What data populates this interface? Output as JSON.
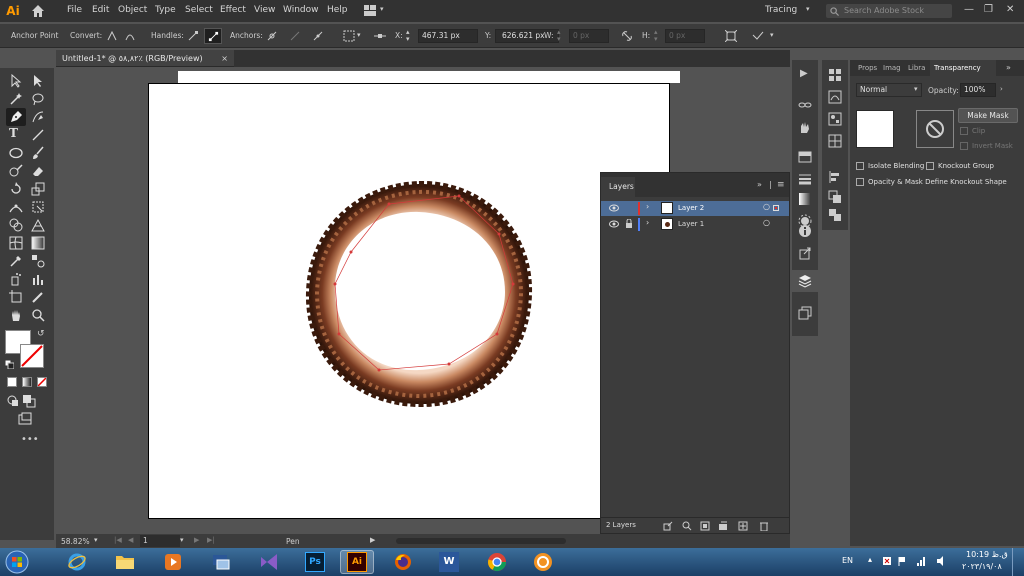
{
  "menubar": {
    "logo": "Ai",
    "menus": [
      "File",
      "Edit",
      "Object",
      "Type",
      "Select",
      "Effect",
      "View",
      "Window",
      "Help"
    ],
    "workspace": "Tracing",
    "search_placeholder": "Search Adobe Stock"
  },
  "control": {
    "tool_label": "Anchor Point",
    "convert_label": "Convert:",
    "handles_label": "Handles:",
    "anchors_label": "Anchors:",
    "x_label": "X:",
    "x_value": "467.31 px",
    "y_label": "Y:",
    "y_value": "626.621 px",
    "w_label": "W:",
    "w_value": "0 px",
    "h_label": "H:",
    "h_value": "0 px"
  },
  "document": {
    "tab_title": "Untitled-1* @ ٥٨,٨٢٪ (RGB/Preview)",
    "close": "×"
  },
  "status": {
    "zoom": "58.82%",
    "page": "1",
    "tool": "Pen"
  },
  "transparency": {
    "tabs": [
      "Props",
      "Imag",
      "Libra",
      "Transparency"
    ],
    "blend_mode": "Normal",
    "opacity_label": "Opacity:",
    "opacity_value": "100%",
    "make_mask": "Make Mask",
    "clip": "Clip",
    "invert_mask": "Invert Mask",
    "isolate_blending": "Isolate Blending",
    "knockout_group": "Knockout Group",
    "opacity_mask": "Opacity & Mask Define Knockout Shape"
  },
  "layers": {
    "title": "Layers",
    "rows": [
      {
        "name": "Layer 2",
        "color": "#e0322f",
        "selected": true
      },
      {
        "name": "Layer 1",
        "color": "#4f7ef7",
        "selected": false
      }
    ],
    "count": "2 Layers"
  },
  "taskbar": {
    "lang": "EN",
    "time": "10:19 ق.ظ",
    "date": "٢٠٢٣/١٩/٠٨"
  },
  "colors": {
    "accent": "#ff9a00",
    "selection": "#5a85b8"
  }
}
